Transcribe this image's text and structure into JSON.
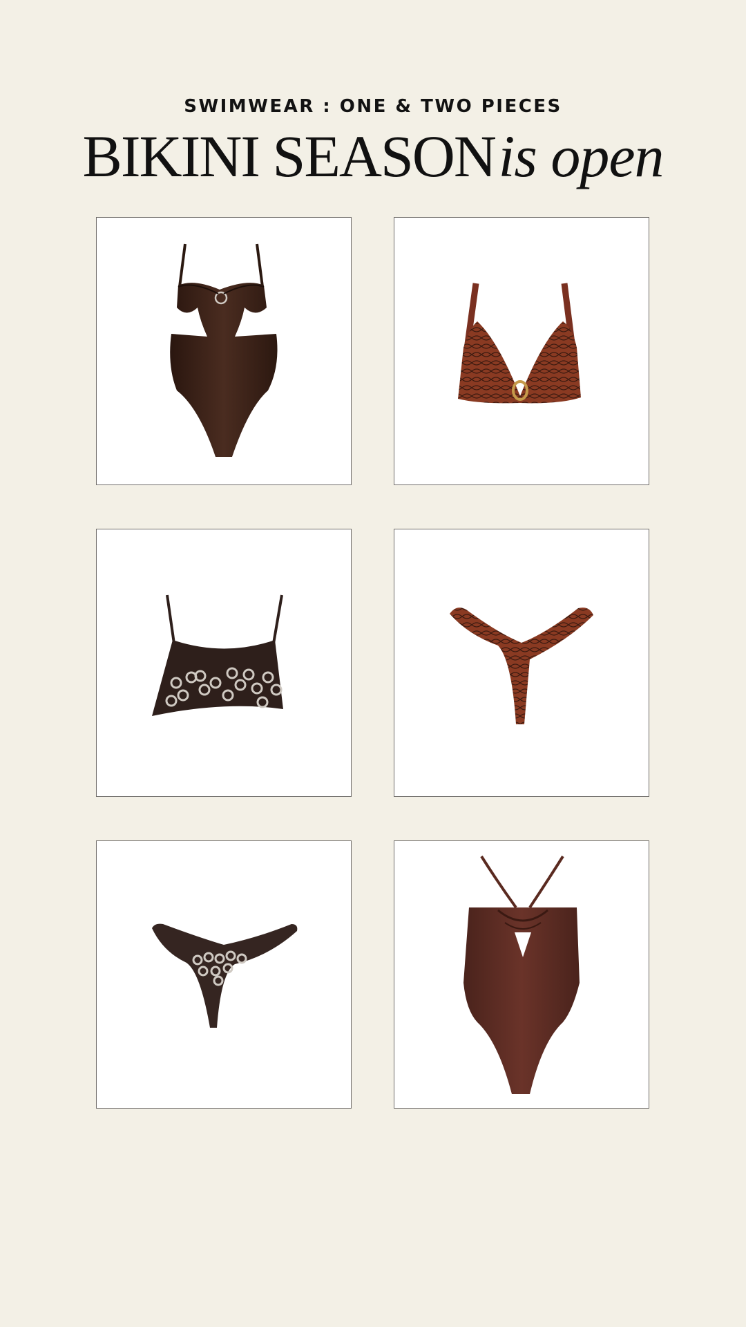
{
  "header": {
    "kicker": "SWIMWEAR : ONE & TWO PIECES",
    "headline_main": "BIKINI SEASON",
    "headline_italic": "is open"
  },
  "products": [
    {
      "icon": "brown-one-piece-swimsuit-icon",
      "color": "#3b2117"
    },
    {
      "icon": "snakeskin-bikini-top-icon",
      "color": "#7a3020"
    },
    {
      "icon": "grommet-bikini-top-icon",
      "color": "#2e1f1b"
    },
    {
      "icon": "snakeskin-bikini-bottom-icon",
      "color": "#7a3020"
    },
    {
      "icon": "grommet-bikini-bottom-icon",
      "color": "#352521"
    },
    {
      "icon": "halter-one-piece-swimsuit-icon",
      "color": "#552a22"
    }
  ],
  "colors": {
    "background": "#f3f0e6",
    "tile_border": "#6f6c69",
    "text": "#111111"
  }
}
